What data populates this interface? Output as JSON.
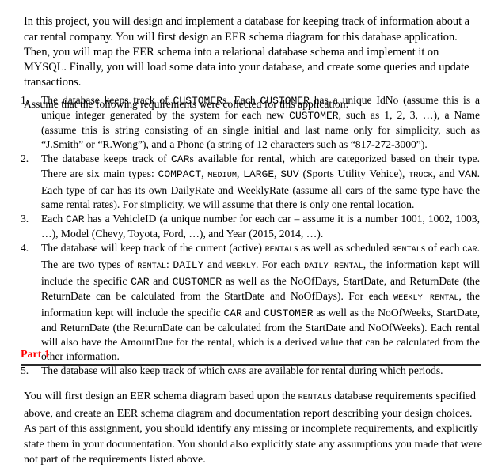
{
  "document": {
    "intro_paragraph": "In this project, you will design and implement a database for keeping track of information about a car rental company. You will first design an EER schema diagram for this database application. Then, you will map the EER schema into a relational database schema and implement it on MYSQL. Finally, you will load some data into your database, and create some queries and update transactions.",
    "assumption_line": "Assume that the following requirements were collected for this application:",
    "requirements": [
      {
        "number": "1.",
        "segments": [
          {
            "type": "text",
            "value": "The database keeps track of "
          },
          {
            "type": "mono",
            "value": "CUSTOMER"
          },
          {
            "type": "text",
            "value": "s. Each "
          },
          {
            "type": "mono",
            "value": "CUSTOMER"
          },
          {
            "type": "text",
            "value": " has a unique IdNo (assume this is a unique integer generated by the system for each new "
          },
          {
            "type": "mono",
            "value": "CUSTOMER"
          },
          {
            "type": "text",
            "value": ", such as 1, 2, 3, …), a Name (assume this is string consisting of an single initial and last name only for simplicity, such as “J.Smith” or “R.Wong”), and a Phone (a string of 12 characters such as “817-272-3000”)."
          }
        ]
      },
      {
        "number": "2.",
        "segments": [
          {
            "type": "text",
            "value": "The database keeps track of "
          },
          {
            "type": "mono",
            "value": "CAR"
          },
          {
            "type": "text",
            "value": "s available for rental, which are categorized based on their type. There are six main types: "
          },
          {
            "type": "mono",
            "value": "COMPACT"
          },
          {
            "type": "text",
            "value": ", "
          },
          {
            "type": "mono-sm",
            "value": "MEDIUM"
          },
          {
            "type": "text",
            "value": ", "
          },
          {
            "type": "mono",
            "value": "LARGE"
          },
          {
            "type": "text",
            "value": ", "
          },
          {
            "type": "mono",
            "value": "SUV"
          },
          {
            "type": "text",
            "value": " (Sports Utility Vehice), "
          },
          {
            "type": "mono-sm",
            "value": "TRUCK"
          },
          {
            "type": "text",
            "value": ", and "
          },
          {
            "type": "mono",
            "value": "VAN"
          },
          {
            "type": "text",
            "value": ". Each type of car has its own DailyRate and WeeklyRate (assume all cars of the same type have the same rental rates). For simplicity, we will assume that there is only one rental location."
          }
        ]
      },
      {
        "number": "3.",
        "segments": [
          {
            "type": "text",
            "value": "Each "
          },
          {
            "type": "mono",
            "value": "CAR"
          },
          {
            "type": "text",
            "value": " has a VehicleID (a unique number for each car – assume it is a number 1001, 1002, 1003, …), Model (Chevy, Toyota, Ford, …), and Year (2015, 2014, …)."
          }
        ]
      },
      {
        "number": "4.",
        "segments": [
          {
            "type": "text",
            "value": "The database will keep track of the current (active) "
          },
          {
            "type": "mono-sm",
            "value": "RENTAL"
          },
          {
            "type": "text",
            "value": "s as well as scheduled "
          },
          {
            "type": "mono-sm",
            "value": "RENTAL"
          },
          {
            "type": "text",
            "value": "s of each "
          },
          {
            "type": "mono-sm",
            "value": "CAR"
          },
          {
            "type": "text",
            "value": ". The are two types of "
          },
          {
            "type": "mono-sm",
            "value": "RENTAL"
          },
          {
            "type": "text",
            "value": ": "
          },
          {
            "type": "mono",
            "value": "DAILY"
          },
          {
            "type": "text",
            "value": " and "
          },
          {
            "type": "mono-sm",
            "value": "WEEKLY"
          },
          {
            "type": "text",
            "value": ". For each "
          },
          {
            "type": "mono-sm",
            "value": "DAILY RENTAL"
          },
          {
            "type": "text",
            "value": ", the information kept will include the specific "
          },
          {
            "type": "mono",
            "value": "CAR"
          },
          {
            "type": "text",
            "value": " and "
          },
          {
            "type": "mono",
            "value": "CUSTOMER"
          },
          {
            "type": "text",
            "value": " as well as the NoOfDays, StartDate, and ReturnDate (the ReturnDate can be calculated from the StartDate and NoOfDays). For each "
          },
          {
            "type": "mono-sm",
            "value": "WEEKLY RENTAL"
          },
          {
            "type": "text",
            "value": ", the information kept will include the specific "
          },
          {
            "type": "mono",
            "value": "CAR"
          },
          {
            "type": "text",
            "value": " and "
          },
          {
            "type": "mono",
            "value": "CUSTOMER"
          },
          {
            "type": "text",
            "value": " as well as the NoOfWeeks, StartDate, and ReturnDate (the ReturnDate can be calculated from the StartDate and NoOfWeeks). Each rental will also have the AmountDue for the rental, which is a derived value that can be calculated from the other information."
          }
        ]
      },
      {
        "number": "5.",
        "segments": [
          {
            "type": "text",
            "value": "The database will also keep track of which "
          },
          {
            "type": "mono-sm",
            "value": "CAR"
          },
          {
            "type": "text",
            "value": "s are available for rental during which periods."
          }
        ]
      }
    ],
    "part_heading": "Part 1",
    "part_heading_color": "#ff0000",
    "closing_segments": [
      {
        "type": "text",
        "value": "You will first design an EER schema diagram based upon the "
      },
      {
        "type": "mono-sm",
        "value": "RENTAL"
      },
      {
        "type": "text",
        "value": "s database requirements specified above, and create an EER schema diagram and documentation report describing your design choices. As part of this assignment, you should identify any missing or incomplete requirements, and explicitly state them in your documentation. You should also explicitly state any assumptions you made that were not part of the requirements listed above."
      }
    ]
  }
}
